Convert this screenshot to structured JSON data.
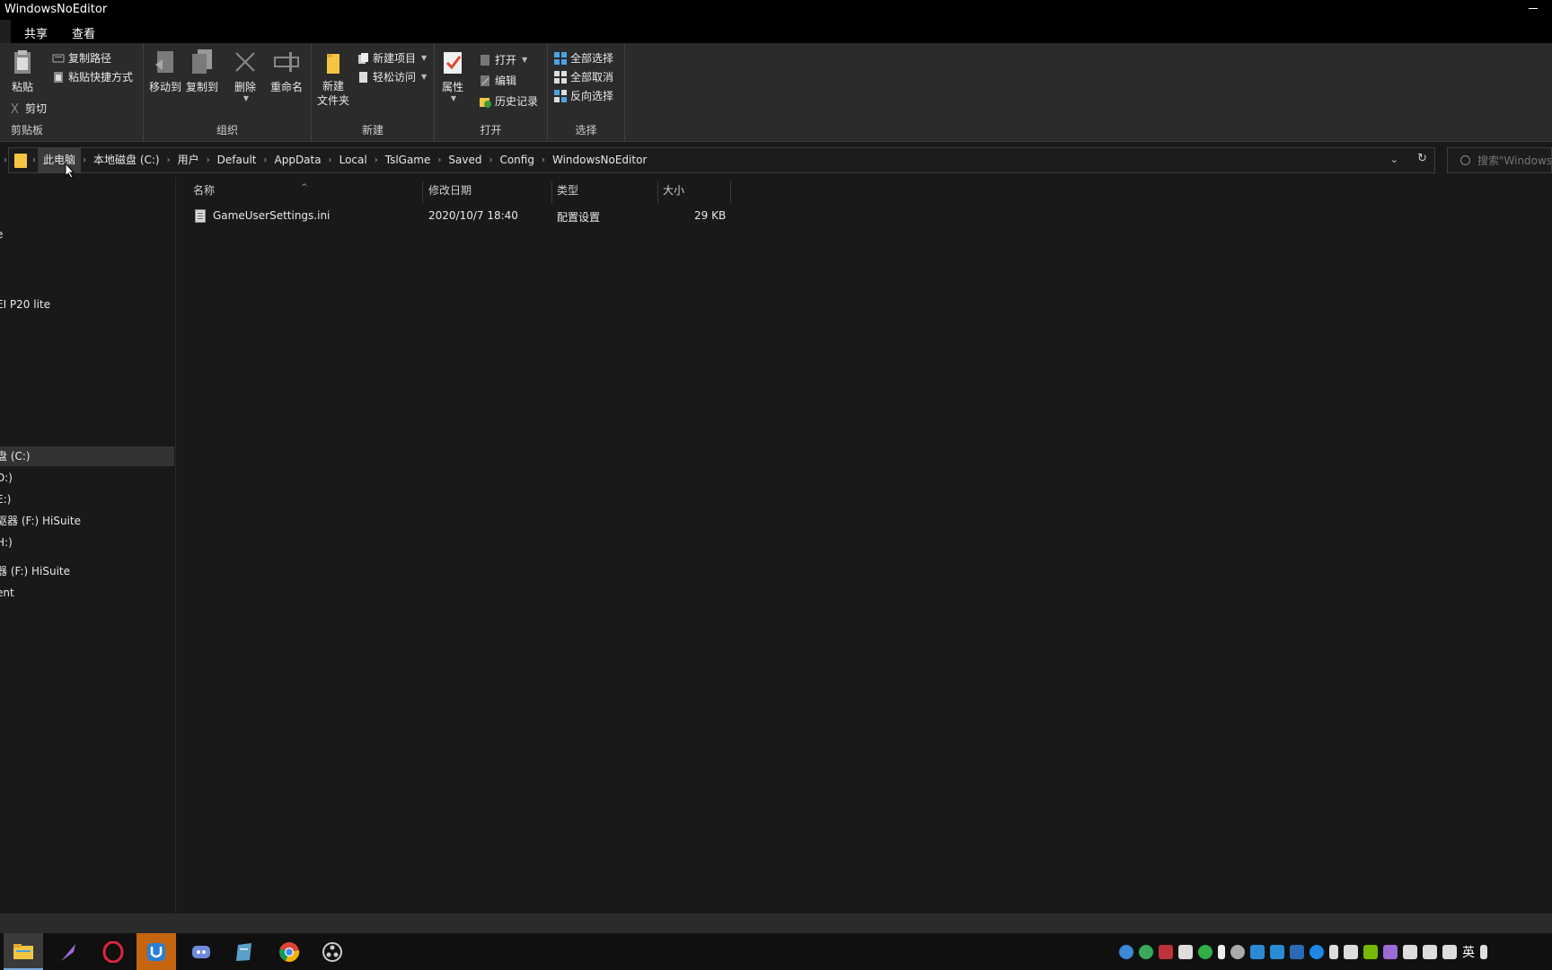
{
  "window": {
    "title": "WindowsNoEditor"
  },
  "ribbon_tabs": [
    {
      "label": "共享"
    },
    {
      "label": "查看"
    }
  ],
  "ribbon": {
    "clipboard": {
      "group_label": "剪贴板",
      "paste_label": "粘贴",
      "copy_path_label": "复制路径",
      "paste_shortcut_label": "粘贴快捷方式",
      "cut_label": "剪切"
    },
    "organize": {
      "group_label": "组织",
      "move_to_label": "移动到",
      "copy_to_label": "复制到",
      "delete_label": "删除",
      "rename_label": "重命名"
    },
    "new": {
      "group_label": "新建",
      "new_folder_label_line1": "新建",
      "new_folder_label_line2": "文件夹",
      "new_item_label": "新建项目",
      "easy_access_label": "轻松访问"
    },
    "open": {
      "group_label": "打开",
      "properties_label": "属性",
      "open_label": "打开",
      "edit_label": "编辑",
      "history_label": "历史记录"
    },
    "select": {
      "group_label": "选择",
      "select_all_label": "全部选择",
      "select_none_label": "全部取消",
      "invert_selection_label": "反向选择"
    }
  },
  "address": {
    "crumbs": [
      {
        "label": "此电脑"
      },
      {
        "label": "本地磁盘 (C:)"
      },
      {
        "label": "用户"
      },
      {
        "label": "Default"
      },
      {
        "label": "AppData"
      },
      {
        "label": "Local"
      },
      {
        "label": "TslGame"
      },
      {
        "label": "Saved"
      },
      {
        "label": "Config"
      },
      {
        "label": "WindowsNoEditor"
      }
    ],
    "search_placeholder": "搜索\"WindowsNoEditor\""
  },
  "navpane": {
    "items": [
      {
        "label": "e"
      },
      {
        "label": ":"
      },
      {
        "label": "EI P20 lite"
      },
      {
        "label": "盘 (C:)",
        "selected": true
      },
      {
        "label": "D:)"
      },
      {
        "label": "E:)"
      },
      {
        "label": "驱器 (F:) HiSuite"
      },
      {
        "label": "H:)"
      },
      {
        "label": "器 (F:) HiSuite"
      },
      {
        "label": "ent"
      }
    ]
  },
  "filelist": {
    "columns": [
      {
        "label": "名称"
      },
      {
        "label": "修改日期"
      },
      {
        "label": "类型"
      },
      {
        "label": "大小"
      }
    ],
    "rows": [
      {
        "name": "GameUserSettings.ini",
        "modified": "2020/10/7 18:40",
        "type": "配置设置",
        "size": "29 KB"
      }
    ]
  },
  "taskbar": {
    "apps": [
      {
        "icon": "file-explorer-icon",
        "color": "#f4c542",
        "active": true
      },
      {
        "icon": "quill-icon",
        "color": "#9b6bd6"
      },
      {
        "icon": "opera-icon",
        "color": "#e0243a"
      },
      {
        "icon": "uplay-icon",
        "color": "#2a7fd4",
        "highlight": true
      },
      {
        "icon": "discord-icon",
        "color": "#7289da"
      },
      {
        "icon": "notepad-icon",
        "color": "#5aa0c8"
      },
      {
        "icon": "chrome-icon",
        "color": "#4285f4"
      },
      {
        "icon": "obs-icon",
        "color": "#cccccc"
      }
    ],
    "tray": {
      "language": "英"
    }
  }
}
